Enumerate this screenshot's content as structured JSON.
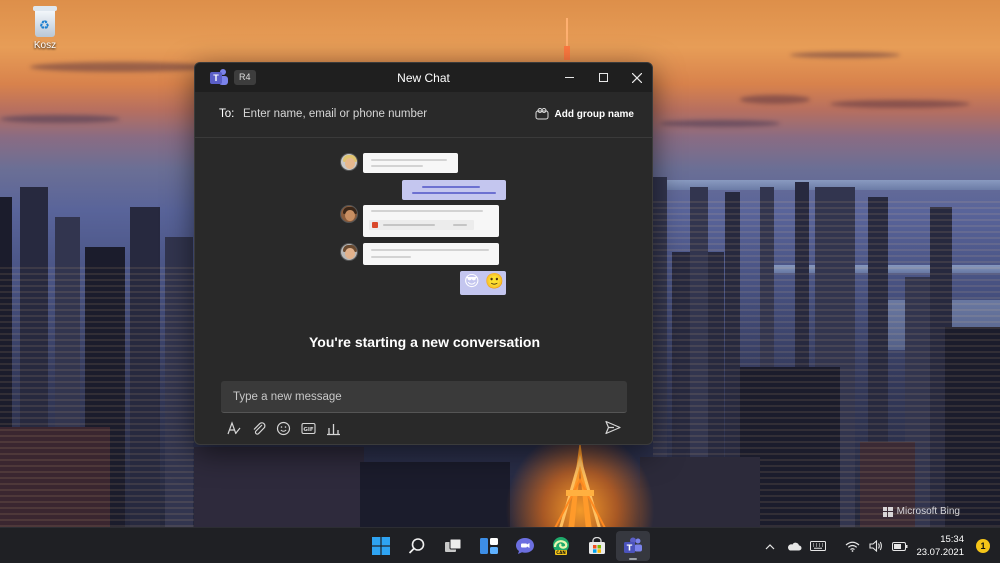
{
  "desktop": {
    "recycle_bin_label": "Kosz",
    "watermark": "Microsoft Bing"
  },
  "window": {
    "title": "New Chat",
    "ring_badge": "R4",
    "minimize_icon": "minimize-icon",
    "maximize_icon": "maximize-icon",
    "close_icon": "close-icon"
  },
  "recipients": {
    "label": "To:",
    "placeholder": "Enter name, email or phone number",
    "value": "",
    "add_group_name_label": "Add group name"
  },
  "illustration": {
    "emojis": [
      "😎",
      "🙂"
    ]
  },
  "conversation": {
    "empty_state_title": "You're starting a new conversation"
  },
  "composer": {
    "placeholder": "Type a new message",
    "value": "",
    "tools": [
      "format-icon",
      "attach-icon",
      "emoji-icon",
      "gif-icon",
      "poll-icon"
    ],
    "send_icon": "send-icon"
  },
  "taskbar": {
    "apps": [
      "start-icon",
      "search-icon",
      "task-view-icon",
      "widgets-icon",
      "teams-chat-icon",
      "edge-canary-icon",
      "store-icon",
      "teams-icon"
    ],
    "active_app": "teams-icon",
    "tray_icons": [
      "chevron-up-icon",
      "onedrive-icon",
      "keyboard-icon",
      "wifi-icon",
      "volume-icon",
      "battery-icon"
    ],
    "time": "15:34",
    "date": "23.07.2021",
    "notification_count": "1"
  },
  "colors": {
    "teams_purple": "#5b5fc7",
    "window_bg": "#292929",
    "titlebar_bg": "#1f1f1f",
    "taskbar_bg": "#1f2024"
  }
}
